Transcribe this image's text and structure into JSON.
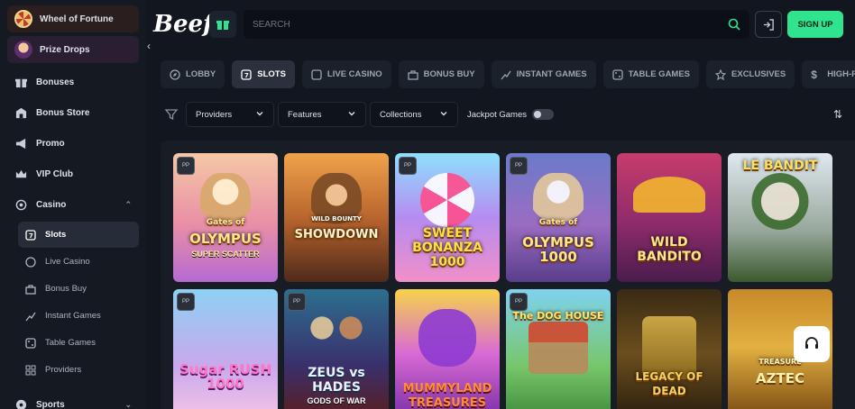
{
  "sidebar": {
    "promos": [
      {
        "label": "Wheel of Fortune"
      },
      {
        "label": "Prize Drops"
      }
    ],
    "items": [
      {
        "label": "Bonuses",
        "icon": "gift-icon"
      },
      {
        "label": "Bonus Store",
        "icon": "store-icon"
      },
      {
        "label": "Promo",
        "icon": "megaphone-icon"
      },
      {
        "label": "VIP Club",
        "icon": "crown-icon"
      }
    ],
    "casino": {
      "label": "Casino",
      "sub": [
        {
          "label": "Slots",
          "active": true
        },
        {
          "label": "Live Casino"
        },
        {
          "label": "Bonus Buy"
        },
        {
          "label": "Instant Games"
        },
        {
          "label": "Table Games"
        },
        {
          "label": "Providers"
        }
      ]
    },
    "sports": {
      "label": "Sports"
    }
  },
  "header": {
    "logo": "Beef",
    "search_placeholder": "SEARCH",
    "signup_label": "SIGN UP"
  },
  "tabs": [
    {
      "label": "LOBBY"
    },
    {
      "label": "SLOTS",
      "active": true
    },
    {
      "label": "LIVE CASINO"
    },
    {
      "label": "BONUS BUY"
    },
    {
      "label": "INSTANT GAMES"
    },
    {
      "label": "TABLE GAMES"
    },
    {
      "label": "EXCLUSIVES"
    },
    {
      "label": "HIGH-ROLLER GAM"
    }
  ],
  "filters": {
    "providers": "Providers",
    "features": "Features",
    "collections": "Collections",
    "jackpot": "Jackpot Games"
  },
  "games": [
    {
      "title": "OLYMPUS",
      "sub": "SUPER SCATTER",
      "top": "Gates of",
      "badge": true
    },
    {
      "title": "SHOWDOWN",
      "sub": "",
      "top": "WILD BOUNTY",
      "badge": false
    },
    {
      "title": "SWEET BONANZA 1000",
      "sub": "",
      "top": "",
      "badge": true
    },
    {
      "title": "OLYMPUS 1000",
      "sub": "",
      "top": "Gates of",
      "badge": true
    },
    {
      "title": "WILD BANDITO",
      "sub": "",
      "top": "",
      "badge": false
    },
    {
      "title": "LE BANDIT",
      "sub": "",
      "top": "",
      "badge": false
    },
    {
      "title": "Sugar RUSH 1000",
      "sub": "",
      "top": "",
      "badge": true
    },
    {
      "title": "ZEUS vs HADES",
      "sub": "GODS OF WAR",
      "top": "",
      "badge": true
    },
    {
      "title": "MUMMYLAND TREASURES",
      "sub": "",
      "top": "",
      "badge": false
    },
    {
      "title": "The DOG HOUSE",
      "sub": "",
      "top": "",
      "badge": true
    },
    {
      "title": "LEGACY OF DEAD",
      "sub": "",
      "top": "",
      "badge": false
    },
    {
      "title": "AZTEC",
      "sub": "",
      "top": "TREASURE",
      "badge": false
    }
  ]
}
